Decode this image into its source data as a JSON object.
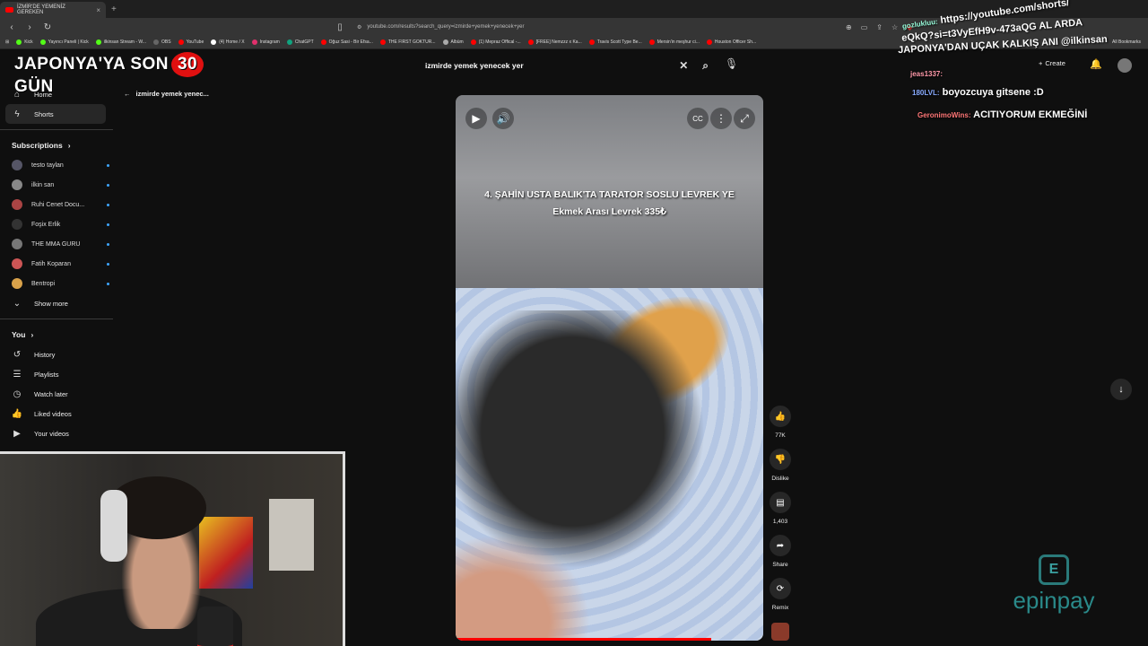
{
  "browser": {
    "tab_title": "İZMİR'DE YEMENİZ GEREKEN",
    "new_tab": "+",
    "url": "youtube.com/results?search_query=izmirde+yemek+yenecek+yer",
    "bookmarks": [
      "Kick",
      "Yayıncı Paneli | Kick",
      "ilkinsan Stream - W...",
      "OBS",
      "YouTube",
      "(4) Home / X",
      "Instagram",
      "ChatGPT",
      "Oğuz Sasi - Bir Efsa...",
      "THE FIRST GOKTUR...",
      "Albüm",
      "(1) Mepraz Offical -...",
      "[FREE] Nemzzz x Ka...",
      "Travis Scott Type Be...",
      "Mersin'in meşhur ci...",
      "Houston Officer Sh..."
    ],
    "all_bookmarks": "All Bookmarks"
  },
  "overlay": {
    "prefix": "JAPONYA'YA SON",
    "days": "30",
    "suffix": "GÜN"
  },
  "chat": {
    "lines": [
      {
        "user": "gozlukluu:",
        "text": "https://youtube.com/shorts/"
      },
      {
        "user": "",
        "text": "eQkQ?si=t3VyEfH9v-473aQG AL ARDA"
      },
      {
        "user": "",
        "text": "JAPONYA'DAN UÇAK KALKIŞ ANI @ilkinsan"
      },
      {
        "user": "jeas1337:",
        "text": ""
      },
      {
        "user": "180LVL:",
        "text": "boyozcuya gitsene :D"
      },
      {
        "user": "GeronimoWins:",
        "text": "ACITIYORUM EKMEĞİNİ"
      }
    ]
  },
  "youtube": {
    "search_value": "izmirde yemek yenecek yer",
    "back_label": "izmirde yemek yenec...",
    "create_label": "Create",
    "nav": [
      {
        "icon": "home-icon",
        "label": "Home"
      },
      {
        "icon": "shorts-icon",
        "label": "Shorts"
      }
    ],
    "subscriptions_label": "Subscriptions",
    "subscriptions": [
      {
        "name": "testo taylan",
        "color": "#556"
      },
      {
        "name": "ilkin san",
        "color": "#888"
      },
      {
        "name": "Ruhi Cenet Docu...",
        "color": "#a44"
      },
      {
        "name": "Foşix Erlik",
        "color": "#333"
      },
      {
        "name": "THE MMA GURU",
        "color": "#777"
      },
      {
        "name": "Fatih Koparan",
        "color": "#c55"
      },
      {
        "name": "Bentropi",
        "color": "#d9a24a"
      }
    ],
    "show_more": "Show more",
    "you_label": "You",
    "you_items": [
      {
        "icon": "history-icon",
        "label": "History"
      },
      {
        "icon": "playlists-icon",
        "label": "Playlists"
      },
      {
        "icon": "watch-later-icon",
        "label": "Watch later"
      },
      {
        "icon": "liked-icon",
        "label": "Liked videos"
      },
      {
        "icon": "your-videos-icon",
        "label": "Your videos"
      }
    ],
    "video": {
      "caption_line1": "4. ŞAHİN USTA BALIK'TA TARATOR SOSLU LEVREK YE",
      "caption_line2": "Ekmek Arası Levrek  335₺",
      "progress": 0.83
    },
    "actions": {
      "like_count": "77K",
      "dislike_label": "Dislike",
      "comment_count": "1,403",
      "share_label": "Share",
      "remix_label": "Remix"
    }
  },
  "sponsor": {
    "name": "epinpay",
    "logo_letter": "E",
    "color": "#2a8a8a"
  }
}
